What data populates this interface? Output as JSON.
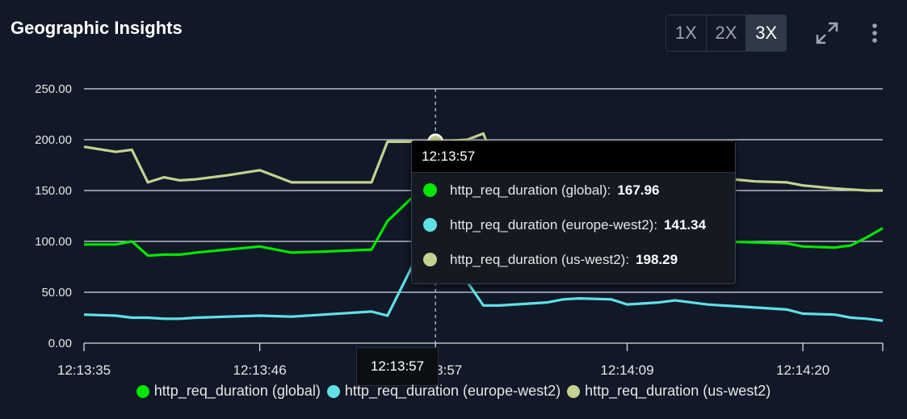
{
  "panel": {
    "title": "Geographic Insights",
    "zoom_options": [
      "1X",
      "2X",
      "3X"
    ],
    "zoom_active": "3X",
    "expand_icon": "expand-icon",
    "menu_icon": "more-vertical-icon"
  },
  "chart_data": {
    "type": "line",
    "ylim": [
      0,
      250
    ],
    "y_ticks": [
      "0.00",
      "50.00",
      "100.00",
      "150.00",
      "200.00",
      "250.00"
    ],
    "x_range": [
      "12:13:35",
      "12:14:25"
    ],
    "x_ticks": [
      "12:13:35",
      "12:13:46",
      "12:13:57",
      "12:14:09",
      "12:14:20"
    ],
    "x": [
      "12:13:35",
      "12:13:37",
      "12:13:38",
      "12:13:39",
      "12:13:40",
      "12:13:41",
      "12:13:42",
      "12:13:44",
      "12:13:46",
      "12:13:48",
      "12:13:50",
      "12:13:53",
      "12:13:54",
      "12:13:56",
      "12:13:57",
      "12:13:59",
      "12:14:00",
      "12:14:01",
      "12:14:02",
      "12:14:04",
      "12:14:05",
      "12:14:06",
      "12:14:08",
      "12:14:09",
      "12:14:11",
      "12:14:12",
      "12:14:14",
      "12:14:15",
      "12:14:17",
      "12:14:19",
      "12:14:20",
      "12:14:22",
      "12:14:23",
      "12:14:24",
      "12:14:25"
    ],
    "series": [
      {
        "name": "http_req_duration (global)",
        "color": "#00e600",
        "values": [
          97,
          97,
          100,
          86,
          87,
          87,
          89,
          92,
          95,
          89,
          90,
          92,
          120,
          150,
          167.96,
          140,
          108,
          100,
          103,
          105,
          103,
          102,
          108,
          102,
          100,
          100,
          105,
          100,
          99,
          98,
          95,
          94,
          96,
          104,
          113
        ]
      },
      {
        "name": "http_req_duration (europe-west2)",
        "color": "#5fe0e6",
        "values": [
          28,
          27,
          25,
          25,
          24,
          24,
          25,
          26,
          27,
          26,
          28,
          31,
          27,
          90,
          141.34,
          60,
          37,
          37,
          38,
          40,
          43,
          44,
          43,
          38,
          40,
          42,
          38,
          37,
          35,
          33,
          29,
          28,
          25,
          24,
          22
        ]
      },
      {
        "name": "http_req_duration (us-west2)",
        "color": "#c5d18f",
        "values": [
          193,
          188,
          190,
          158,
          163,
          160,
          161,
          165,
          170,
          158,
          158,
          158,
          198,
          198,
          198.29,
          200,
          206,
          165,
          162,
          162,
          163,
          187,
          163,
          162,
          166,
          172,
          174,
          162,
          159,
          158,
          155,
          152,
          151,
          150,
          150
        ]
      }
    ],
    "tooltip": {
      "time": "12:13:57",
      "rows": [
        {
          "label": "http_req_duration (global):",
          "value": "167.96",
          "color": "#00e600"
        },
        {
          "label": "http_req_duration (europe-west2):",
          "value": "141.34",
          "color": "#5fe0e6"
        },
        {
          "label": "http_req_duration (us-west2):",
          "value": "198.29",
          "color": "#c5d18f"
        }
      ]
    },
    "crosshair_label": "12:13:57",
    "legend": [
      "http_req_duration (global)",
      "http_req_duration (europe-west2)",
      "http_req_duration (us-west2)"
    ],
    "grid": true,
    "legend_position": "bottom"
  }
}
